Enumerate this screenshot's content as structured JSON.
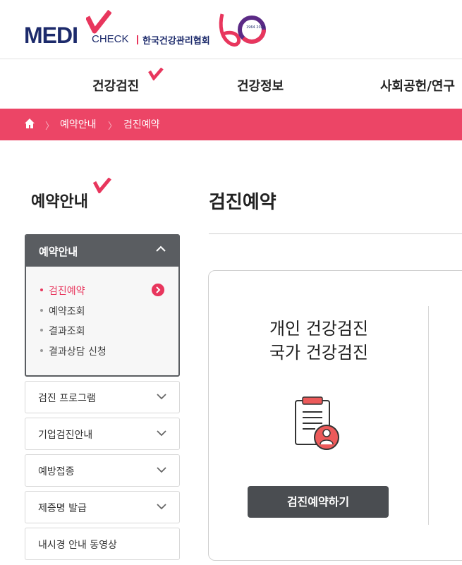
{
  "brand": {
    "logo_medi": "MEDI",
    "logo_check": "CHECK",
    "org_name": "한국건강관리협회",
    "anniversary_years": "1964 2024",
    "accent_color": "#ec4566",
    "navy_color": "#1c2a6b"
  },
  "gnb": {
    "items": [
      {
        "label": "건강검진"
      },
      {
        "label": "건강정보"
      },
      {
        "label": "사회공헌/연구"
      }
    ]
  },
  "breadcrumb": {
    "home_icon": "home-icon",
    "items": [
      "예약안내",
      "검진예약"
    ]
  },
  "sidebar": {
    "title": "예약안내",
    "active_group": {
      "label": "예약안내",
      "items": [
        {
          "label": "검진예약",
          "active": true
        },
        {
          "label": "예약조회",
          "active": false
        },
        {
          "label": "결과조회",
          "active": false
        },
        {
          "label": "결과상담 신청",
          "active": false
        }
      ]
    },
    "groups": [
      {
        "label": "검진 프로그램"
      },
      {
        "label": "기업검진안내"
      },
      {
        "label": "예방접종"
      },
      {
        "label": "제증명 발급"
      },
      {
        "label": "내시경 안내 동영상"
      }
    ]
  },
  "main": {
    "title": "검진예약",
    "card": {
      "line1": "개인 건강검진",
      "line2": "국가 건강검진",
      "icon": "clipboard-user-icon",
      "button_label": "검진예약하기"
    }
  }
}
